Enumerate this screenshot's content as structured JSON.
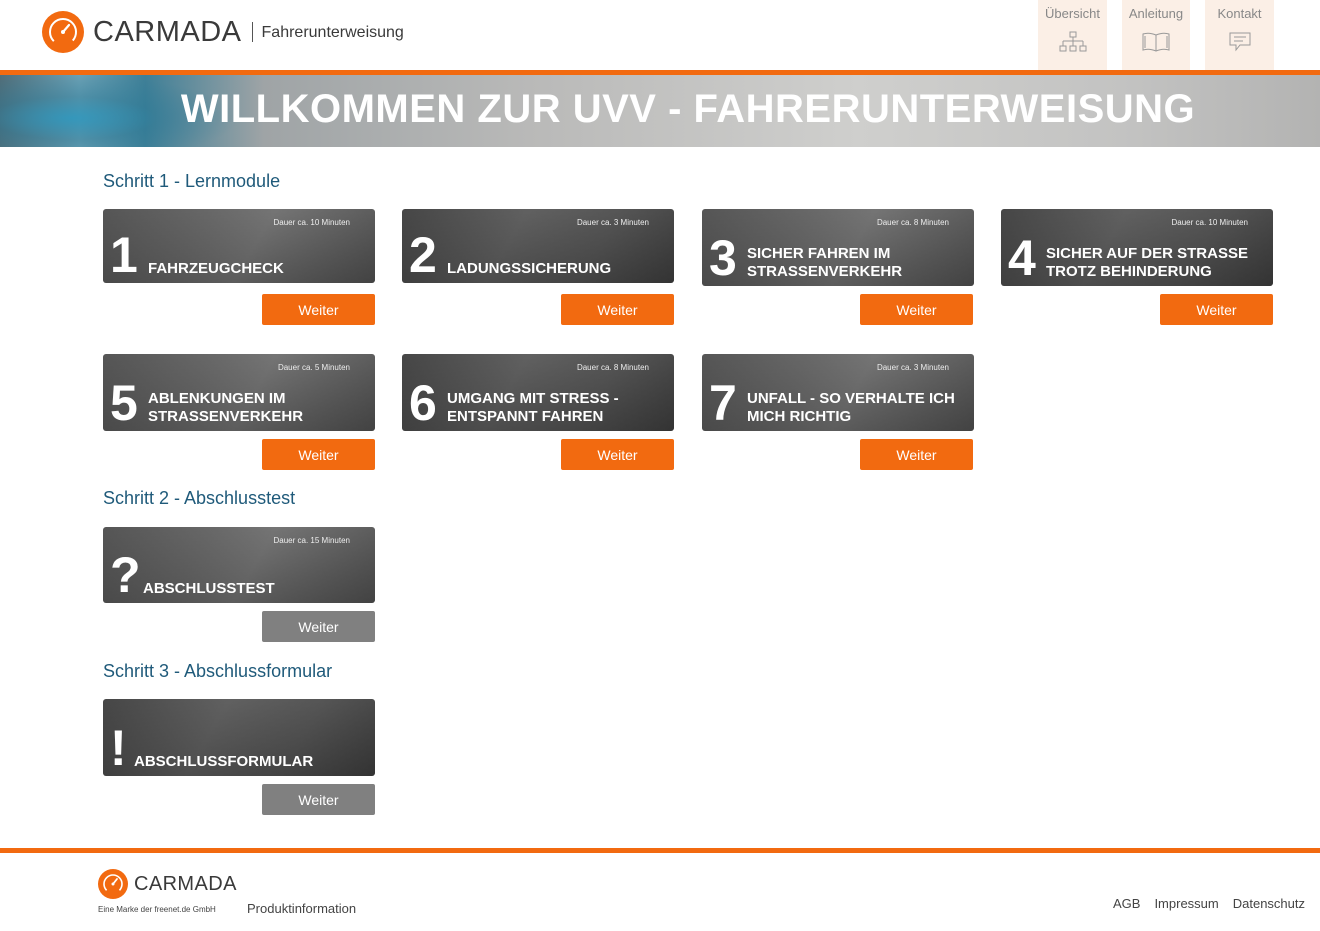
{
  "header": {
    "brand": "CARMADA",
    "subtitle": "Fahrerunterweisung",
    "nav": [
      {
        "label": "Übersicht",
        "icon": "sitemap-icon"
      },
      {
        "label": "Anleitung",
        "icon": "book-icon"
      },
      {
        "label": "Kontakt",
        "icon": "chat-icon"
      }
    ]
  },
  "hero": {
    "title": "WILLKOMMEN ZUR UVV - FAHRERUNTERWEISUNG"
  },
  "steps": {
    "step1": "Schritt 1 - Lernmodule",
    "step2": "Schritt 2 - Abschlusstest",
    "step3": "Schritt 3 - Abschlussformular"
  },
  "modules": [
    {
      "num": "1",
      "title": "FAHRZEUGCHECK",
      "duration": "Dauer ca. 10 Minuten",
      "button": "Weiter"
    },
    {
      "num": "2",
      "title": "LADUNGSSICHERUNG",
      "duration": "Dauer ca. 3 Minuten",
      "button": "Weiter"
    },
    {
      "num": "3",
      "title_line1": "SICHER FAHREN IM",
      "title_line2": "STRASSENVERKEHR",
      "duration": "Dauer ca. 8 Minuten",
      "button": "Weiter"
    },
    {
      "num": "4",
      "title_line1": "SICHER AUF DER STRASSE",
      "title_line2": "TROTZ BEHINDERUNG",
      "duration": "Dauer ca. 10 Minuten",
      "button": "Weiter"
    },
    {
      "num": "5",
      "title_line1": "ABLENKUNGEN IM",
      "title_line2": "STRASSENVERKEHR",
      "duration": "Dauer ca. 5 Minuten",
      "button": "Weiter"
    },
    {
      "num": "6",
      "title_line1": "UMGANG MIT STRESS -",
      "title_line2": "ENTSPANNT FAHREN",
      "duration": "Dauer ca. 8 Minuten",
      "button": "Weiter"
    },
    {
      "num": "7",
      "title_line1": "UNFALL - SO VERHALTE ICH",
      "title_line2": "MICH RICHTIG",
      "duration": "Dauer ca. 3 Minuten",
      "button": "Weiter"
    }
  ],
  "test": {
    "symbol": "?",
    "title": "ABSCHLUSSTEST",
    "duration": "Dauer ca. 15 Minuten",
    "button": "Weiter"
  },
  "form": {
    "symbol": "!",
    "title": "ABSCHLUSSFORMULAR",
    "button": "Weiter"
  },
  "footer": {
    "brand": "CARMADA",
    "tagline": "Eine Marke der freenet.de GmbH",
    "product": "Produktinformation",
    "links": [
      "AGB",
      "Impressum",
      "Datenschutz"
    ]
  },
  "colors": {
    "accent": "#f26a10",
    "heading": "#1f5a7a",
    "disabled": "#808080"
  }
}
